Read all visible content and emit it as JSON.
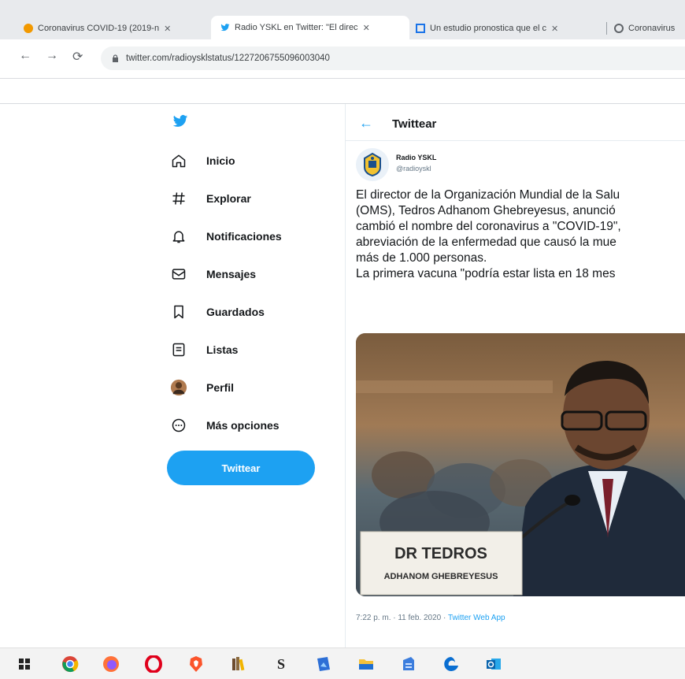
{
  "browser": {
    "tabs": [
      {
        "label": "Coronavirus COVID-19 (2019-n",
        "close": "✕",
        "favicon_color": "#f29900"
      },
      {
        "label": "Radio YSKL en Twitter: \"El direc",
        "close": "✕",
        "favicon_color": "#1da1f2"
      },
      {
        "label": "Un estudio pronostica que el c",
        "close": "✕",
        "favicon_color": "#1a73e8"
      },
      {
        "label": "Coronavirus",
        "favicon_color": "#5f6368"
      }
    ],
    "active_tab_index": 1,
    "url": "twitter.com/radioysklstatus/1227206755096003040",
    "nav": {
      "back": "←",
      "forward": "→",
      "reload": "⟳"
    }
  },
  "sidebar": {
    "logo": "twitter-bird-icon",
    "items": [
      {
        "label": "Inicio",
        "icon": "home-icon"
      },
      {
        "label": "Explorar",
        "icon": "hashtag-icon"
      },
      {
        "label": "Notificaciones",
        "icon": "bell-icon"
      },
      {
        "label": "Mensajes",
        "icon": "envelope-icon"
      },
      {
        "label": "Guardados",
        "icon": "bookmark-icon"
      },
      {
        "label": "Listas",
        "icon": "list-icon"
      },
      {
        "label": "Perfil",
        "icon": "avatar-icon"
      },
      {
        "label": "Más opciones",
        "icon": "more-options-icon"
      }
    ],
    "tweet_button": "Twittear"
  },
  "main": {
    "back": "←",
    "title": "Twittear",
    "tweet": {
      "author_name": "Radio YSKL",
      "author_handle": "@radioyskl",
      "text_lines": [
        "El director de la Organización Mundial de la Salu",
        "(OMS), Tedros Adhanom Ghebreyesus, anunció",
        "cambió el nombre del coronavirus a \"COVID-19\",",
        "abreviación de la enfermedad que causó la mue",
        "más de 1.000 personas.",
        "La primera vacuna \"podría estar lista en 18 mes"
      ],
      "image": {
        "placard_line1": "DR TEDROS",
        "placard_line2": "ADHANOM GHEBREYESUS"
      },
      "time": "7:22 p. m. · 11 feb. 2020 · ",
      "source_app": "Twitter Web App"
    }
  },
  "taskbar": {
    "items": [
      "windows-start-icon",
      "chrome-icon",
      "firefox-icon",
      "opera-icon",
      "brave-icon",
      "library-icon",
      "skype-icon",
      "photos-icon",
      "file-explorer-icon",
      "word-docs-icon",
      "edge-icon",
      "outlook-icon"
    ]
  },
  "colors": {
    "accent": "#1da1f2",
    "text": "#14171a",
    "muted": "#657786"
  }
}
